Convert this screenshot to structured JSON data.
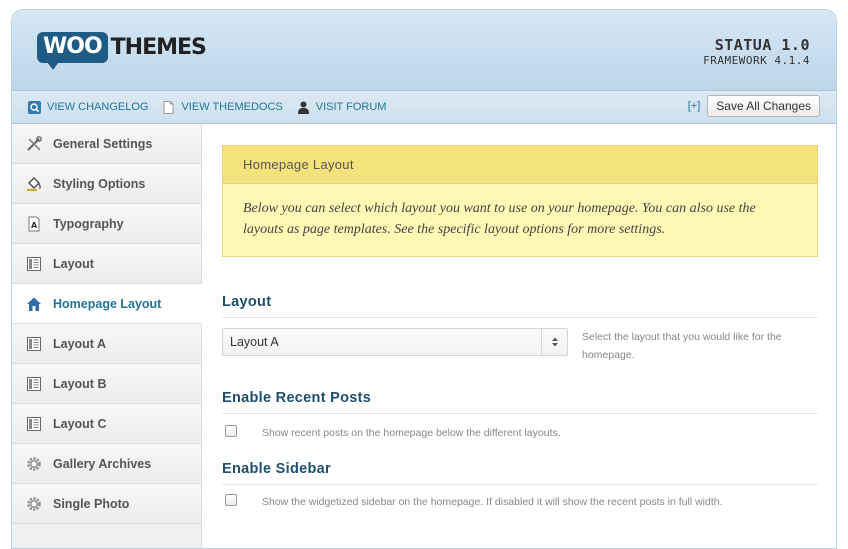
{
  "header": {
    "logo_woo": "WOO",
    "logo_themes": "THEMES",
    "theme_name": "STATUA 1.0",
    "framework_version": "FRAMEWORK 4.1.4"
  },
  "toolbar": {
    "links": [
      {
        "label": "VIEW CHANGELOG",
        "icon": "search-icon"
      },
      {
        "label": "VIEW THEMEDOCS",
        "icon": "document-icon"
      },
      {
        "label": "VISIT FORUM",
        "icon": "user-icon"
      }
    ],
    "expand_label": "[+]",
    "save_label": "Save All Changes"
  },
  "sidebar": {
    "items": [
      {
        "label": "General Settings",
        "icon": "tools-icon"
      },
      {
        "label": "Styling Options",
        "icon": "paint-bucket-icon"
      },
      {
        "label": "Typography",
        "icon": "typography-icon"
      },
      {
        "label": "Layout",
        "icon": "layout-icon"
      },
      {
        "label": "Homepage Layout",
        "icon": "home-icon",
        "active": true
      },
      {
        "label": "Layout A",
        "icon": "layout-icon"
      },
      {
        "label": "Layout B",
        "icon": "layout-icon"
      },
      {
        "label": "Layout C",
        "icon": "layout-icon"
      },
      {
        "label": "Gallery Archives",
        "icon": "gear-icon"
      },
      {
        "label": "Single Photo",
        "icon": "gear-icon"
      }
    ]
  },
  "main": {
    "notice_title": "Homepage Layout",
    "notice_text": "Below you can select which layout you want to use on your homepage. You can also use the layouts as page templates. See the specific layout options for more settings.",
    "layout": {
      "title": "Layout",
      "value": "Layout A",
      "desc": "Select the layout that you would like for the homepage."
    },
    "recent_posts": {
      "title": "Enable Recent Posts",
      "desc": "Show recent posts on the homepage below the different layouts."
    },
    "sidebar_opt": {
      "title": "Enable Sidebar",
      "desc": "Show the widgetized sidebar on the homepage. If disabled it will show the recent posts in full width."
    }
  },
  "colors": {
    "accent": "#21759b",
    "heading": "#1e4f6e",
    "notice_bg": "#fff8b5",
    "notice_head_bg": "#f4e27c"
  }
}
